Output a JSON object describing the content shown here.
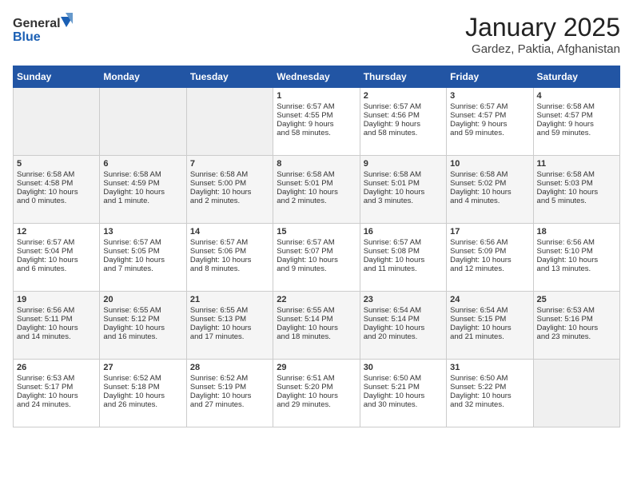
{
  "header": {
    "logo_line1": "General",
    "logo_line2": "Blue",
    "title": "January 2025",
    "subtitle": "Gardez, Paktia, Afghanistan"
  },
  "weekdays": [
    "Sunday",
    "Monday",
    "Tuesday",
    "Wednesday",
    "Thursday",
    "Friday",
    "Saturday"
  ],
  "weeks": [
    [
      {
        "day": "",
        "info": ""
      },
      {
        "day": "",
        "info": ""
      },
      {
        "day": "",
        "info": ""
      },
      {
        "day": "1",
        "info": "Sunrise: 6:57 AM\nSunset: 4:55 PM\nDaylight: 9 hours\nand 58 minutes."
      },
      {
        "day": "2",
        "info": "Sunrise: 6:57 AM\nSunset: 4:56 PM\nDaylight: 9 hours\nand 58 minutes."
      },
      {
        "day": "3",
        "info": "Sunrise: 6:57 AM\nSunset: 4:57 PM\nDaylight: 9 hours\nand 59 minutes."
      },
      {
        "day": "4",
        "info": "Sunrise: 6:58 AM\nSunset: 4:57 PM\nDaylight: 9 hours\nand 59 minutes."
      }
    ],
    [
      {
        "day": "5",
        "info": "Sunrise: 6:58 AM\nSunset: 4:58 PM\nDaylight: 10 hours\nand 0 minutes."
      },
      {
        "day": "6",
        "info": "Sunrise: 6:58 AM\nSunset: 4:59 PM\nDaylight: 10 hours\nand 1 minute."
      },
      {
        "day": "7",
        "info": "Sunrise: 6:58 AM\nSunset: 5:00 PM\nDaylight: 10 hours\nand 2 minutes."
      },
      {
        "day": "8",
        "info": "Sunrise: 6:58 AM\nSunset: 5:01 PM\nDaylight: 10 hours\nand 2 minutes."
      },
      {
        "day": "9",
        "info": "Sunrise: 6:58 AM\nSunset: 5:01 PM\nDaylight: 10 hours\nand 3 minutes."
      },
      {
        "day": "10",
        "info": "Sunrise: 6:58 AM\nSunset: 5:02 PM\nDaylight: 10 hours\nand 4 minutes."
      },
      {
        "day": "11",
        "info": "Sunrise: 6:58 AM\nSunset: 5:03 PM\nDaylight: 10 hours\nand 5 minutes."
      }
    ],
    [
      {
        "day": "12",
        "info": "Sunrise: 6:57 AM\nSunset: 5:04 PM\nDaylight: 10 hours\nand 6 minutes."
      },
      {
        "day": "13",
        "info": "Sunrise: 6:57 AM\nSunset: 5:05 PM\nDaylight: 10 hours\nand 7 minutes."
      },
      {
        "day": "14",
        "info": "Sunrise: 6:57 AM\nSunset: 5:06 PM\nDaylight: 10 hours\nand 8 minutes."
      },
      {
        "day": "15",
        "info": "Sunrise: 6:57 AM\nSunset: 5:07 PM\nDaylight: 10 hours\nand 9 minutes."
      },
      {
        "day": "16",
        "info": "Sunrise: 6:57 AM\nSunset: 5:08 PM\nDaylight: 10 hours\nand 11 minutes."
      },
      {
        "day": "17",
        "info": "Sunrise: 6:56 AM\nSunset: 5:09 PM\nDaylight: 10 hours\nand 12 minutes."
      },
      {
        "day": "18",
        "info": "Sunrise: 6:56 AM\nSunset: 5:10 PM\nDaylight: 10 hours\nand 13 minutes."
      }
    ],
    [
      {
        "day": "19",
        "info": "Sunrise: 6:56 AM\nSunset: 5:11 PM\nDaylight: 10 hours\nand 14 minutes."
      },
      {
        "day": "20",
        "info": "Sunrise: 6:55 AM\nSunset: 5:12 PM\nDaylight: 10 hours\nand 16 minutes."
      },
      {
        "day": "21",
        "info": "Sunrise: 6:55 AM\nSunset: 5:13 PM\nDaylight: 10 hours\nand 17 minutes."
      },
      {
        "day": "22",
        "info": "Sunrise: 6:55 AM\nSunset: 5:14 PM\nDaylight: 10 hours\nand 18 minutes."
      },
      {
        "day": "23",
        "info": "Sunrise: 6:54 AM\nSunset: 5:14 PM\nDaylight: 10 hours\nand 20 minutes."
      },
      {
        "day": "24",
        "info": "Sunrise: 6:54 AM\nSunset: 5:15 PM\nDaylight: 10 hours\nand 21 minutes."
      },
      {
        "day": "25",
        "info": "Sunrise: 6:53 AM\nSunset: 5:16 PM\nDaylight: 10 hours\nand 23 minutes."
      }
    ],
    [
      {
        "day": "26",
        "info": "Sunrise: 6:53 AM\nSunset: 5:17 PM\nDaylight: 10 hours\nand 24 minutes."
      },
      {
        "day": "27",
        "info": "Sunrise: 6:52 AM\nSunset: 5:18 PM\nDaylight: 10 hours\nand 26 minutes."
      },
      {
        "day": "28",
        "info": "Sunrise: 6:52 AM\nSunset: 5:19 PM\nDaylight: 10 hours\nand 27 minutes."
      },
      {
        "day": "29",
        "info": "Sunrise: 6:51 AM\nSunset: 5:20 PM\nDaylight: 10 hours\nand 29 minutes."
      },
      {
        "day": "30",
        "info": "Sunrise: 6:50 AM\nSunset: 5:21 PM\nDaylight: 10 hours\nand 30 minutes."
      },
      {
        "day": "31",
        "info": "Sunrise: 6:50 AM\nSunset: 5:22 PM\nDaylight: 10 hours\nand 32 minutes."
      },
      {
        "day": "",
        "info": ""
      }
    ]
  ]
}
